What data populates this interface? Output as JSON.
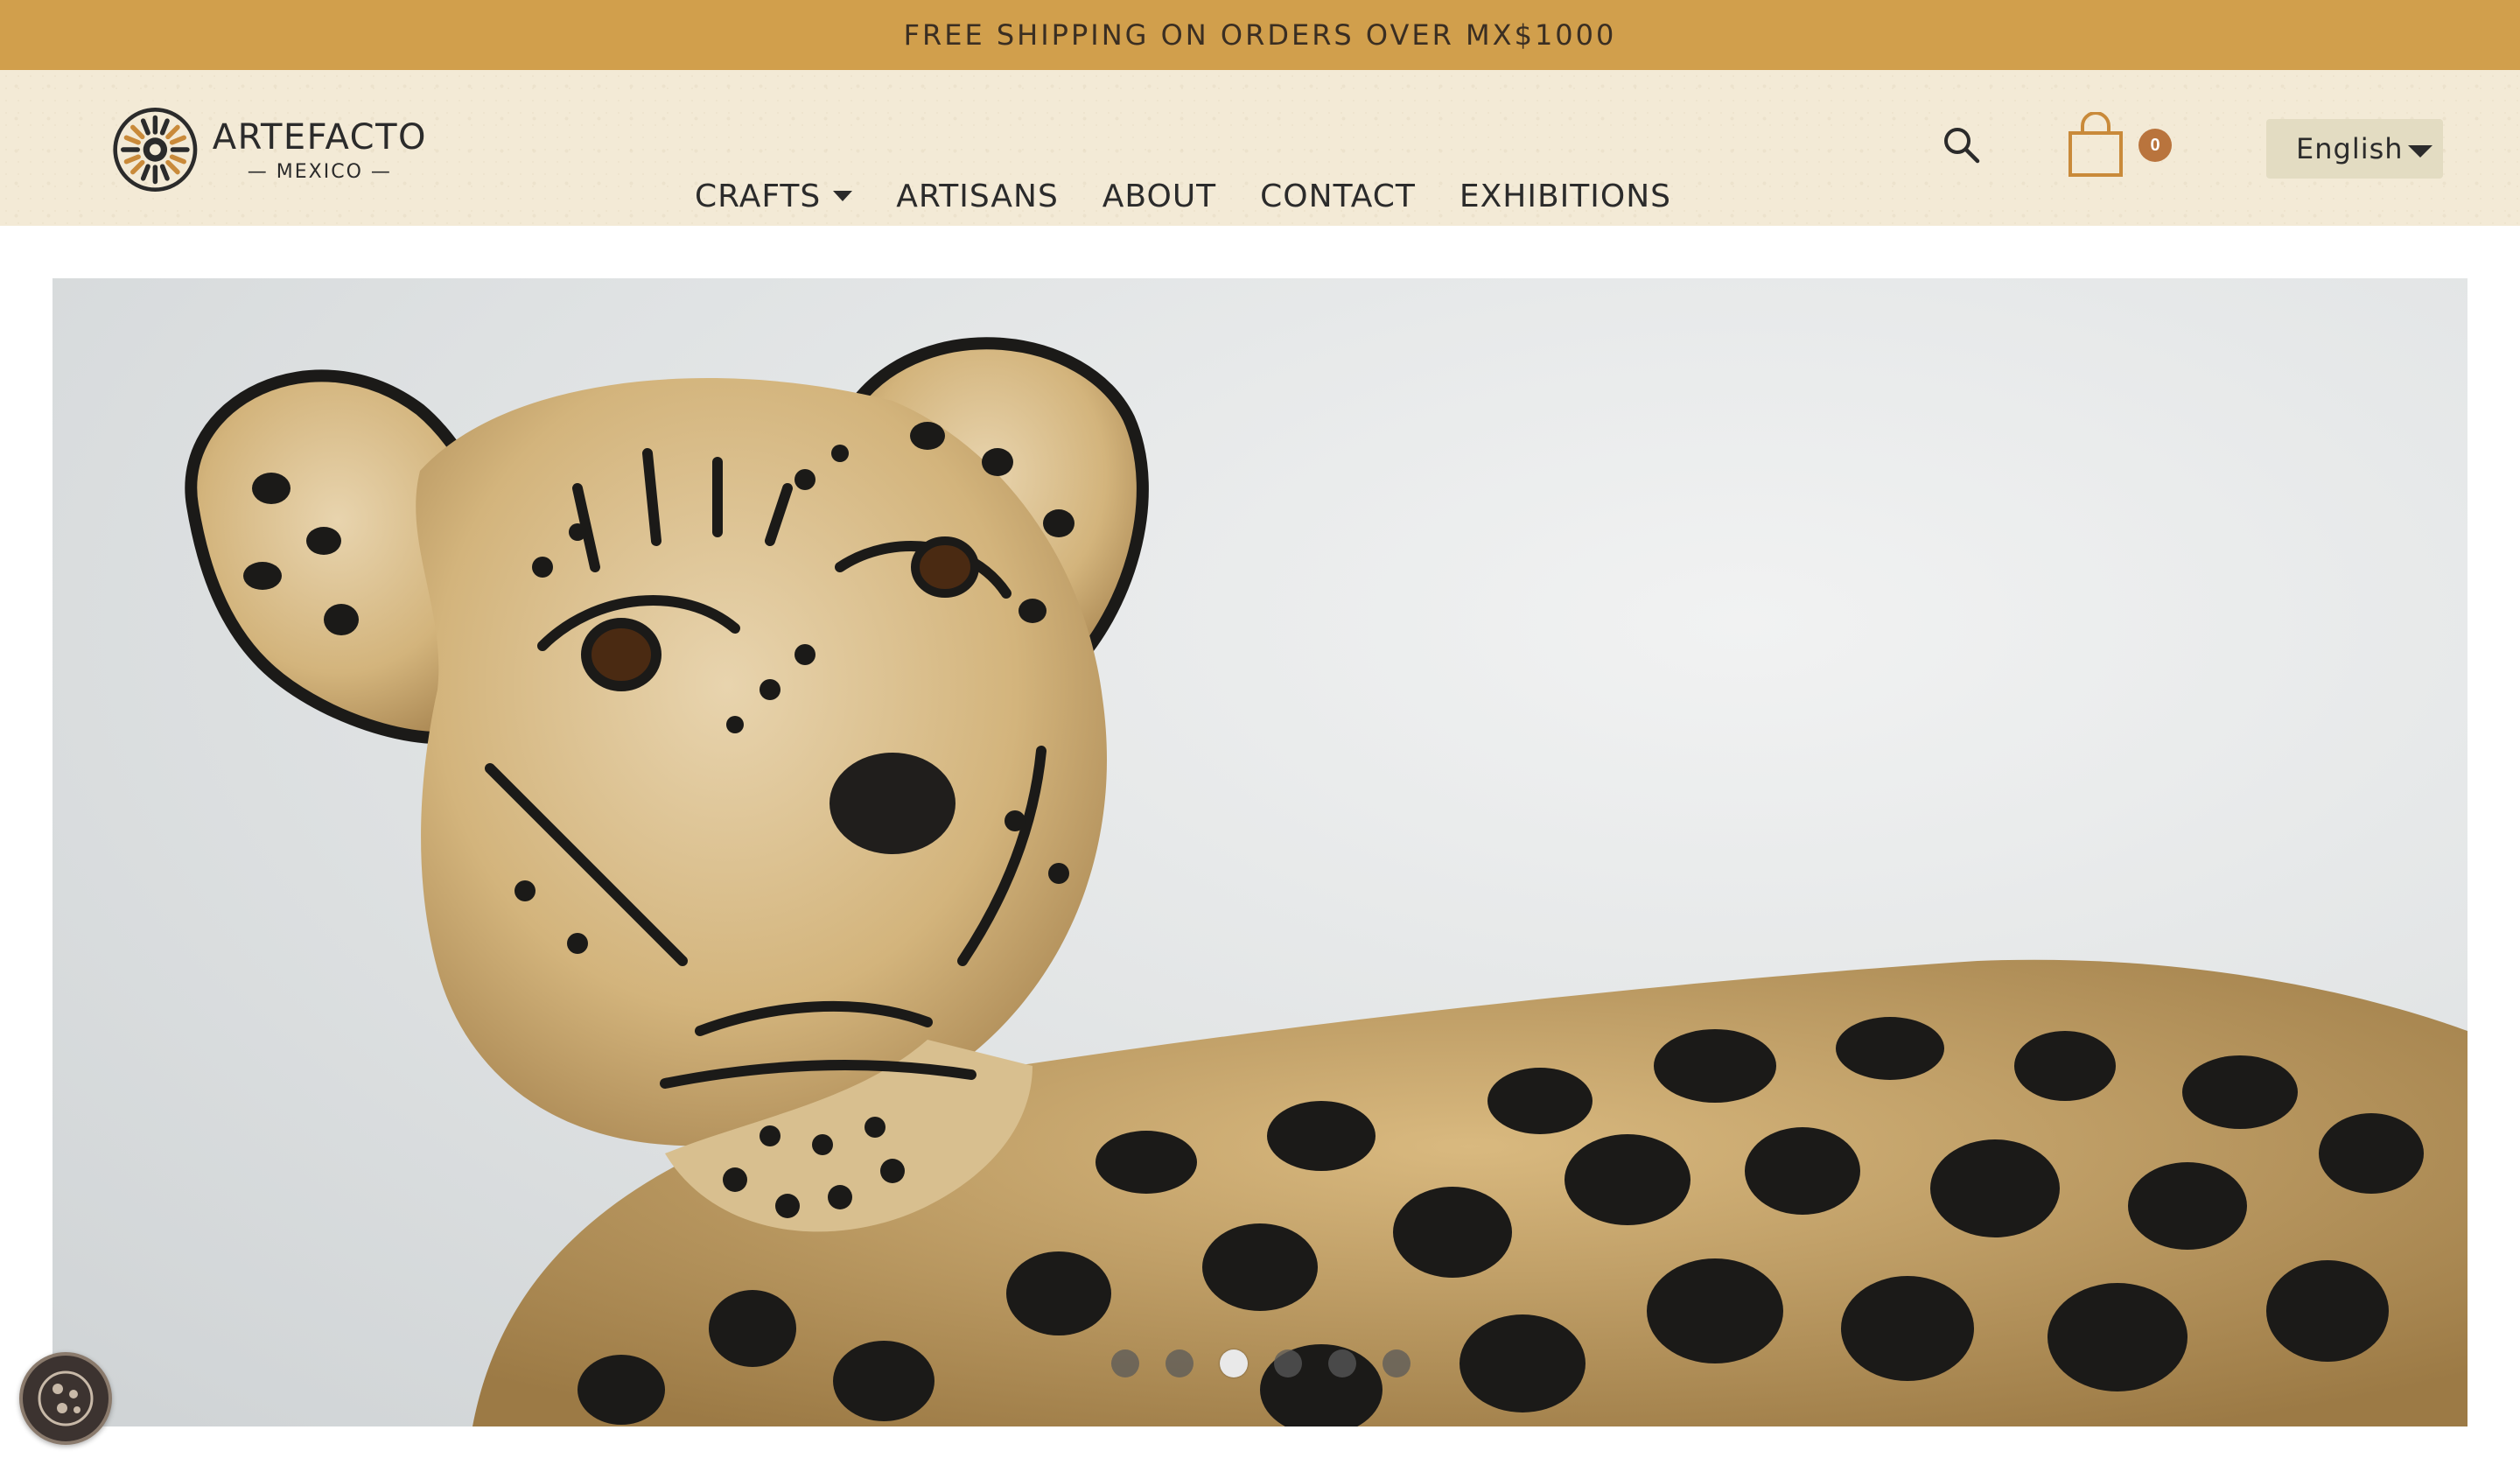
{
  "promo": {
    "text": "FREE SHIPPING ON ORDERS OVER MX$1000"
  },
  "brand": {
    "name": "ARTEFACTO",
    "sub": "— MEXICO —"
  },
  "nav": {
    "items": [
      {
        "label": "CRAFTS",
        "has_dropdown": true
      },
      {
        "label": "ARTISANS"
      },
      {
        "label": "ABOUT"
      },
      {
        "label": "CONTACT"
      },
      {
        "label": "EXHIBITIONS"
      }
    ]
  },
  "cart": {
    "count": "0"
  },
  "language": {
    "selected": "English"
  },
  "slider": {
    "slide_count": 6,
    "active_index": 2
  },
  "icons": {
    "search": "search-icon",
    "cart": "shopping-bag-icon",
    "cookie": "cookie-icon",
    "language_caret": "chevron-down-icon"
  },
  "colors": {
    "promo_bg": "#d19f4c",
    "header_bg": "#f3ead6",
    "accent": "#b9743d",
    "language_bg": "#e3dcc2",
    "text": "#2b2b2b"
  }
}
